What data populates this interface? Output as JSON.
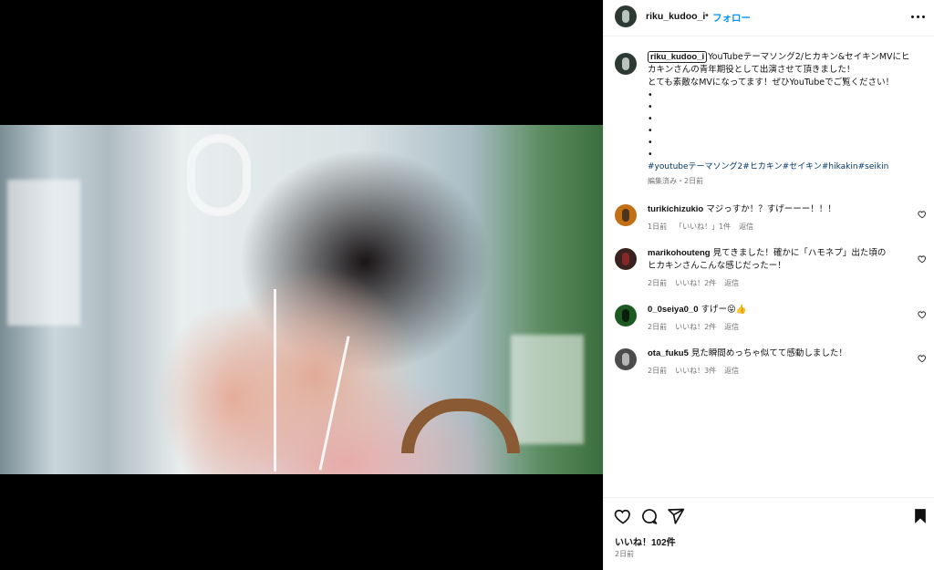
{
  "post": {
    "username": "riku_kudoo_i",
    "separator": "•",
    "follow_label": "フォロー",
    "caption": {
      "lines": [
        "YouTubeテーマソング2/ヒカキン&セイキンMVにヒ",
        "カキンさんの青年期役として出演させて頂きました！",
        "とても素敵なMVになってます！ぜひYouTubeでご覧ください！"
      ],
      "bullets": [
        "•",
        "•",
        "•",
        "•",
        "•",
        "•"
      ],
      "hashtags": [
        "#youtubeテーマソング2",
        "#ヒカキン",
        "#セイキン",
        "#hikakin",
        "#seikin"
      ],
      "meta": "編集済み・2日前"
    }
  },
  "comments": [
    {
      "username": "turikichizukio",
      "text": "マジっすか！？すげーーー！！！",
      "time": "1日前",
      "likes": "「いいね！」1件",
      "reply": "返信",
      "avatar": "ochre-avatar"
    },
    {
      "username": "marikohouteng",
      "text_lines": [
        "見てきました！確かに「ハモネプ」出た頃の",
        "ヒカキンさんこんな感じだったー！"
      ],
      "time": "2日前",
      "likes": "いいね！2件",
      "reply": "返信",
      "avatar": "red-avatar"
    },
    {
      "username": "0_0seiya0_0",
      "text": "すげー😝👍",
      "time": "2日前",
      "likes": "いいね！2件",
      "reply": "返信",
      "avatar": "green-avatar"
    },
    {
      "username": "ota_fuku5",
      "text": "見た瞬間めっちゃ似てて感動しました！",
      "time": "2日前",
      "likes": "いいね！3件",
      "reply": "返信",
      "avatar": "gray-avatar"
    }
  ],
  "footer": {
    "likes_count": "いいね！102件",
    "date": "2日前",
    "icons": [
      "heart-icon",
      "comment-icon",
      "share-icon",
      "bookmark-icon"
    ]
  },
  "colors": {
    "follow": "#0095f6",
    "hashtag": "#00376b",
    "meta": "#737373"
  }
}
